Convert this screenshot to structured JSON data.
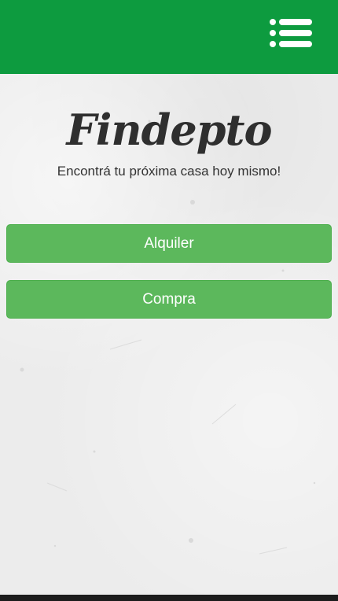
{
  "header": {
    "menu_icon": "hamburger-list-icon",
    "background_color": "#0d9b3f"
  },
  "brand": {
    "logo_text": "Findepto",
    "tagline": "Encontrá tu próxima casa hoy mismo!"
  },
  "actions": {
    "rent_label": "Alquiler",
    "buy_label": "Compra",
    "button_color": "#5cb85c"
  }
}
